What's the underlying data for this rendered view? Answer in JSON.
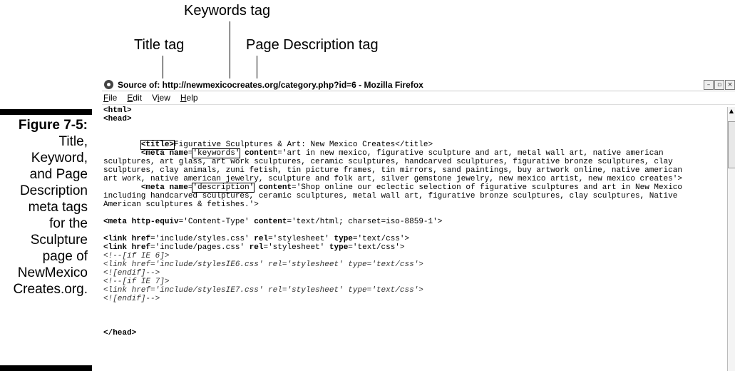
{
  "callouts": {
    "keywords": "Keywords tag",
    "title": "Title tag",
    "description": "Page Description tag"
  },
  "caption": {
    "figure": "Figure 7-5:",
    "lines": [
      "Title,",
      "Keyword,",
      "and Page",
      "Description",
      "meta tags",
      "for the",
      "Sculpture",
      "page of",
      "NewMexico",
      "Creates.org."
    ]
  },
  "window": {
    "title": "Source of: http://newmexicocreates.org/category.php?id=6 - Mozilla Firefox",
    "controls": [
      "–",
      "▫",
      "×"
    ]
  },
  "menubar": {
    "file": {
      "u": "F",
      "rest": "ile"
    },
    "edit": {
      "u": "E",
      "rest": "dit"
    },
    "view": {
      "pre": "V",
      "u": "i",
      "rest": "ew"
    },
    "help": {
      "u": "H",
      "rest": "elp"
    }
  },
  "source": {
    "html_open": "<html>",
    "head_open": "<head>",
    "title_tag": "<title>",
    "title_text": "Figurative Sculptures & Art: New Mexico Creates</title>",
    "meta1_prefix": "<meta",
    "meta1_name_attr": "name",
    "meta1_name_val": "'keywords'",
    "meta1_content_attr": "content",
    "meta1_content_1": "='art in new mexico, figurative sculpture and art, metal wall art, native american",
    "meta1_content_2": "sculptures, art glass, art work sculptures, ceramic sculptures, handcarved sculptures, figurative bronze sculptures, clay",
    "meta1_content_3": "sculptures, clay animals, zuni fetish, tin picture frames, tin mirrors, sand paintings, buy artwork online, native american",
    "meta1_content_4": "art work, native american jewelry, sculpture and folk art, silver gemstone jewelry, new mexico artist, new mexico creates'>",
    "meta2_name_val": "'description'",
    "meta2_content_1": "='Shop online our eclectic selection of figurative sculptures and art in New Mexico",
    "meta2_content_2": "including handcarved sculptures, ceramic sculptures, metal wall art, figurative bronze sculptures, clay sculptures, Native",
    "meta2_content_3": "American sculptures & fetishes.'>",
    "meta3_http": "http-equiv",
    "meta3_http_val": "='Content-Type' ",
    "meta3_content_val": "='text/html; charset=iso-8859-1'>",
    "link_kw": "<link",
    "href_kw": "href",
    "rel_kw": "rel",
    "type_kw": "type",
    "link1_href": "='include/styles.css' ",
    "link2_href": "='include/pages.css' ",
    "rel_val": "='stylesheet' ",
    "type_val": "='text/css'>",
    "comment1": "<!--[if IE 6]>",
    "comment2": "<link href='include/stylesIE6.css' rel='stylesheet' type='text/css'>",
    "comment3": "<![endif]-->",
    "comment4": "<!--[if IE 7]>",
    "comment5": "<link href='include/stylesIE7.css' rel='stylesheet' type='text/css'>",
    "comment6": "<![endif]-->",
    "head_close": "</head>"
  }
}
